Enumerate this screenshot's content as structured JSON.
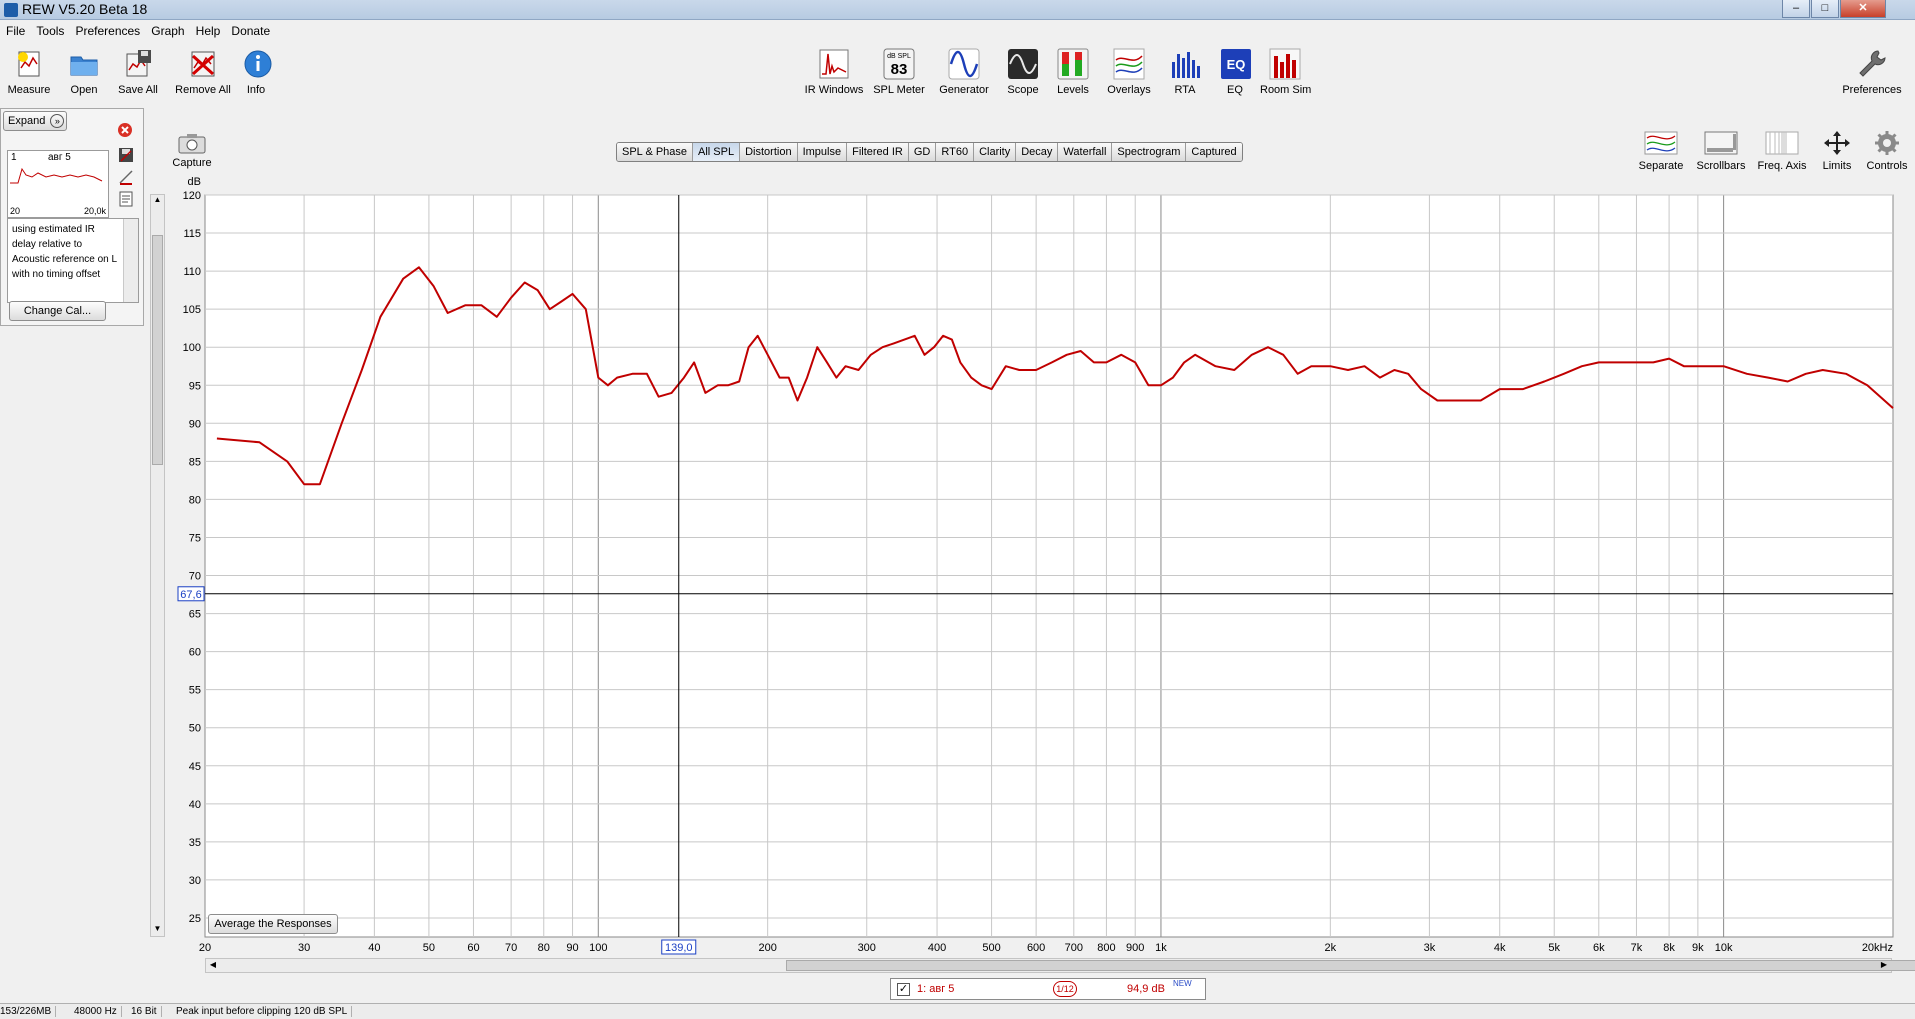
{
  "window": {
    "title": "REW V5.20 Beta 18",
    "minimize": "–",
    "maximize": "□",
    "close": "✕"
  },
  "menu": [
    "File",
    "Tools",
    "Preferences",
    "Graph",
    "Help",
    "Donate"
  ],
  "toolbar_left": [
    {
      "label": "Measure",
      "icon": "measure-icon"
    },
    {
      "label": "Open",
      "icon": "folder-open-icon"
    },
    {
      "label": "Save All",
      "icon": "save-all-icon"
    },
    {
      "label": "Remove All",
      "icon": "remove-all-icon"
    },
    {
      "label": "Info",
      "icon": "info-icon"
    }
  ],
  "toolbar_center": [
    {
      "label": "IR Windows",
      "icon": "ir-windows-icon"
    },
    {
      "label": "SPL Meter",
      "icon": "spl-meter-icon",
      "badge_top": "dB SPL",
      "badge_value": "83"
    },
    {
      "label": "Generator",
      "icon": "generator-icon"
    },
    {
      "label": "Scope",
      "icon": "scope-icon"
    },
    {
      "label": "Levels",
      "icon": "levels-icon"
    },
    {
      "label": "Overlays",
      "icon": "overlays-icon"
    },
    {
      "label": "RTA",
      "icon": "rta-icon"
    },
    {
      "label": "EQ",
      "icon": "eq-icon"
    },
    {
      "label": "Room Sim",
      "icon": "room-sim-icon"
    }
  ],
  "toolbar_right": {
    "label": "Preferences",
    "icon": "wrench-icon"
  },
  "left_panel": {
    "expand_label": "Expand",
    "measurement_number": "1",
    "measurement_name": "авг 5",
    "thumb_x_min": "20",
    "thumb_x_max": "20,0k",
    "notes": "using estimated IR delay relative to Acoustic reference on  L with no timing offset",
    "change_cal_label": "Change Cal..."
  },
  "capture_label": "Capture",
  "graph_tabs": [
    {
      "label": "SPL & Phase",
      "active": false
    },
    {
      "label": "All SPL",
      "active": true
    },
    {
      "label": "Distortion",
      "active": false
    },
    {
      "label": "Impulse",
      "active": false
    },
    {
      "label": "Filtered IR",
      "active": false
    },
    {
      "label": "GD",
      "active": false
    },
    {
      "label": "RT60",
      "active": false
    },
    {
      "label": "Clarity",
      "active": false
    },
    {
      "label": "Decay",
      "active": false
    },
    {
      "label": "Waterfall",
      "active": false
    },
    {
      "label": "Spectrogram",
      "active": false
    },
    {
      "label": "Captured",
      "active": false
    }
  ],
  "graph_controls": [
    {
      "label": "Separate",
      "icon": "separate-icon"
    },
    {
      "label": "Scrollbars",
      "icon": "scrollbars-icon"
    },
    {
      "label": "Freq. Axis",
      "icon": "freq-axis-icon"
    },
    {
      "label": "Limits",
      "icon": "limits-icon"
    },
    {
      "label": "Controls",
      "icon": "gear-icon"
    }
  ],
  "average_button_label": "Average the Responses",
  "cursor": {
    "x_label": "139,0",
    "y_label": "67,6"
  },
  "legend": {
    "checked": "✓",
    "name": "1: авг 5",
    "smoothing": "1/12",
    "value": "94,9 dB",
    "badge": "NEW"
  },
  "status": {
    "memory": "153/226MB",
    "rate": "48000 Hz",
    "bits": "16 Bit",
    "message": "Peak input before clipping 120 dB SPL"
  },
  "colors": {
    "trace": "#c00000",
    "grid": "#c8c8c8",
    "cursor": "#000000",
    "cursor_label": "#1a3fc4"
  },
  "chart_data": {
    "type": "line",
    "ylabel": "dB",
    "xlabel": "",
    "xscale": "log",
    "xlim": [
      20,
      20000
    ],
    "ylim": [
      22.5,
      120
    ],
    "y_ticks": [
      25,
      30,
      35,
      40,
      45,
      50,
      55,
      60,
      65,
      70,
      75,
      80,
      85,
      90,
      95,
      100,
      105,
      110,
      115,
      120
    ],
    "x_ticks": [
      {
        "v": 20,
        "t": "20"
      },
      {
        "v": 30,
        "t": "30"
      },
      {
        "v": 40,
        "t": "40"
      },
      {
        "v": 50,
        "t": "50"
      },
      {
        "v": 60,
        "t": "60"
      },
      {
        "v": 70,
        "t": "70"
      },
      {
        "v": 80,
        "t": "80"
      },
      {
        "v": 90,
        "t": "90"
      },
      {
        "v": 100,
        "t": "100"
      },
      {
        "v": 200,
        "t": "200"
      },
      {
        "v": 300,
        "t": "300"
      },
      {
        "v": 400,
        "t": "400"
      },
      {
        "v": 500,
        "t": "500"
      },
      {
        "v": 600,
        "t": "600"
      },
      {
        "v": 700,
        "t": "700"
      },
      {
        "v": 800,
        "t": "800"
      },
      {
        "v": 900,
        "t": "900"
      },
      {
        "v": 1000,
        "t": "1k"
      },
      {
        "v": 2000,
        "t": "2k"
      },
      {
        "v": 3000,
        "t": "3k"
      },
      {
        "v": 4000,
        "t": "4k"
      },
      {
        "v": 5000,
        "t": "5k"
      },
      {
        "v": 6000,
        "t": "6k"
      },
      {
        "v": 7000,
        "t": "7k"
      },
      {
        "v": 8000,
        "t": "8k"
      },
      {
        "v": 9000,
        "t": "9k"
      },
      {
        "v": 10000,
        "t": "10k"
      },
      {
        "v": 20000,
        "t": "20kHz"
      }
    ],
    "series": [
      {
        "name": "1: авг 5",
        "points": [
          [
            21,
            88
          ],
          [
            25,
            87.5
          ],
          [
            28,
            85
          ],
          [
            30,
            82
          ],
          [
            32,
            82
          ],
          [
            35,
            90
          ],
          [
            38,
            97
          ],
          [
            41,
            104
          ],
          [
            45,
            109
          ],
          [
            48,
            110.5
          ],
          [
            51,
            108
          ],
          [
            54,
            104.5
          ],
          [
            58,
            105.5
          ],
          [
            62,
            105.5
          ],
          [
            66,
            104
          ],
          [
            70,
            106.5
          ],
          [
            74,
            108.5
          ],
          [
            78,
            107.5
          ],
          [
            82,
            105
          ],
          [
            86,
            106
          ],
          [
            90,
            107
          ],
          [
            95,
            105
          ],
          [
            100,
            96
          ],
          [
            104,
            95
          ],
          [
            108,
            96
          ],
          [
            115,
            96.5
          ],
          [
            122,
            96.5
          ],
          [
            128,
            93.5
          ],
          [
            135,
            94
          ],
          [
            142,
            96
          ],
          [
            148,
            98
          ],
          [
            155,
            94
          ],
          [
            163,
            95
          ],
          [
            170,
            95
          ],
          [
            178,
            95.5
          ],
          [
            185,
            100
          ],
          [
            192,
            101.5
          ],
          [
            200,
            99
          ],
          [
            210,
            96
          ],
          [
            218,
            96
          ],
          [
            226,
            93
          ],
          [
            235,
            96
          ],
          [
            245,
            100
          ],
          [
            255,
            98
          ],
          [
            265,
            96
          ],
          [
            275,
            97.5
          ],
          [
            290,
            97
          ],
          [
            305,
            99
          ],
          [
            320,
            100
          ],
          [
            335,
            100.5
          ],
          [
            350,
            101
          ],
          [
            365,
            101.5
          ],
          [
            380,
            99
          ],
          [
            395,
            100
          ],
          [
            410,
            101.5
          ],
          [
            425,
            101
          ],
          [
            440,
            98
          ],
          [
            460,
            96
          ],
          [
            480,
            95
          ],
          [
            500,
            94.5
          ],
          [
            530,
            97.5
          ],
          [
            560,
            97
          ],
          [
            600,
            97
          ],
          [
            640,
            98
          ],
          [
            680,
            99
          ],
          [
            720,
            99.5
          ],
          [
            760,
            98
          ],
          [
            800,
            98
          ],
          [
            850,
            99
          ],
          [
            900,
            98
          ],
          [
            950,
            95
          ],
          [
            1000,
            95
          ],
          [
            1050,
            96
          ],
          [
            1100,
            98
          ],
          [
            1150,
            99
          ],
          [
            1250,
            97.5
          ],
          [
            1350,
            97
          ],
          [
            1450,
            99
          ],
          [
            1550,
            100
          ],
          [
            1650,
            99
          ],
          [
            1750,
            96.5
          ],
          [
            1850,
            97.5
          ],
          [
            2000,
            97.5
          ],
          [
            2150,
            97
          ],
          [
            2300,
            97.5
          ],
          [
            2450,
            96
          ],
          [
            2600,
            97
          ],
          [
            2750,
            96.5
          ],
          [
            2900,
            94.5
          ],
          [
            3100,
            93
          ],
          [
            3400,
            93
          ],
          [
            3700,
            93
          ],
          [
            4000,
            94.5
          ],
          [
            4400,
            94.5
          ],
          [
            4800,
            95.5
          ],
          [
            5200,
            96.5
          ],
          [
            5600,
            97.5
          ],
          [
            6000,
            98
          ],
          [
            6500,
            98
          ],
          [
            7000,
            98
          ],
          [
            7500,
            98
          ],
          [
            8000,
            98.5
          ],
          [
            8500,
            97.5
          ],
          [
            9000,
            97.5
          ],
          [
            9500,
            97.5
          ],
          [
            10000,
            97.5
          ],
          [
            11000,
            96.5
          ],
          [
            12000,
            96
          ],
          [
            13000,
            95.5
          ],
          [
            14000,
            96.5
          ],
          [
            15000,
            97
          ],
          [
            16500,
            96.5
          ],
          [
            18000,
            95
          ],
          [
            20000,
            92
          ]
        ]
      }
    ]
  }
}
